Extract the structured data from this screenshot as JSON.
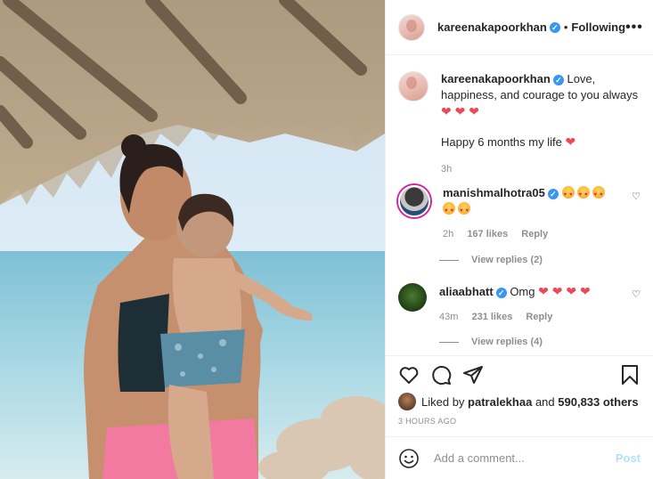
{
  "post": {
    "username": "kareenakapoorkhan",
    "follow_separator": "•",
    "follow_status": "Following",
    "more_label": "•••"
  },
  "caption": {
    "username": "kareenakapoorkhan",
    "text": "Love, happiness, and courage to you always",
    "hearts": "❤ ❤ ❤",
    "line2": "Happy 6 months my life",
    "line2_heart": "❤",
    "time": "3h"
  },
  "comments": [
    {
      "username": "manishmalhotra05",
      "time": "2h",
      "likes": "167 likes",
      "reply": "Reply",
      "view_replies": "View replies (2)"
    },
    {
      "username": "aliaabhatt",
      "text": "Omg",
      "hearts": "❤ ❤ ❤ ❤",
      "time": "43m",
      "likes": "231 likes",
      "reply": "Reply",
      "view_replies": "View replies (4)"
    }
  ],
  "liked_by": {
    "prefix": "Liked by",
    "user": "patralekhaa",
    "middle": "and",
    "others": "590,833 others"
  },
  "timestamp": "3 HOURS AGO",
  "add_comment": {
    "placeholder": "Add a comment...",
    "post_label": "Post"
  },
  "colors": {
    "verified": "#3897f0",
    "heart": "#ed4956",
    "post_disabled": "#b2dffc",
    "muted": "#8e8e8e"
  },
  "icons": [
    "heart-icon",
    "comment-icon",
    "share-icon",
    "save-icon",
    "smile-icon",
    "verified-badge-icon",
    "comment-like-icon"
  ]
}
